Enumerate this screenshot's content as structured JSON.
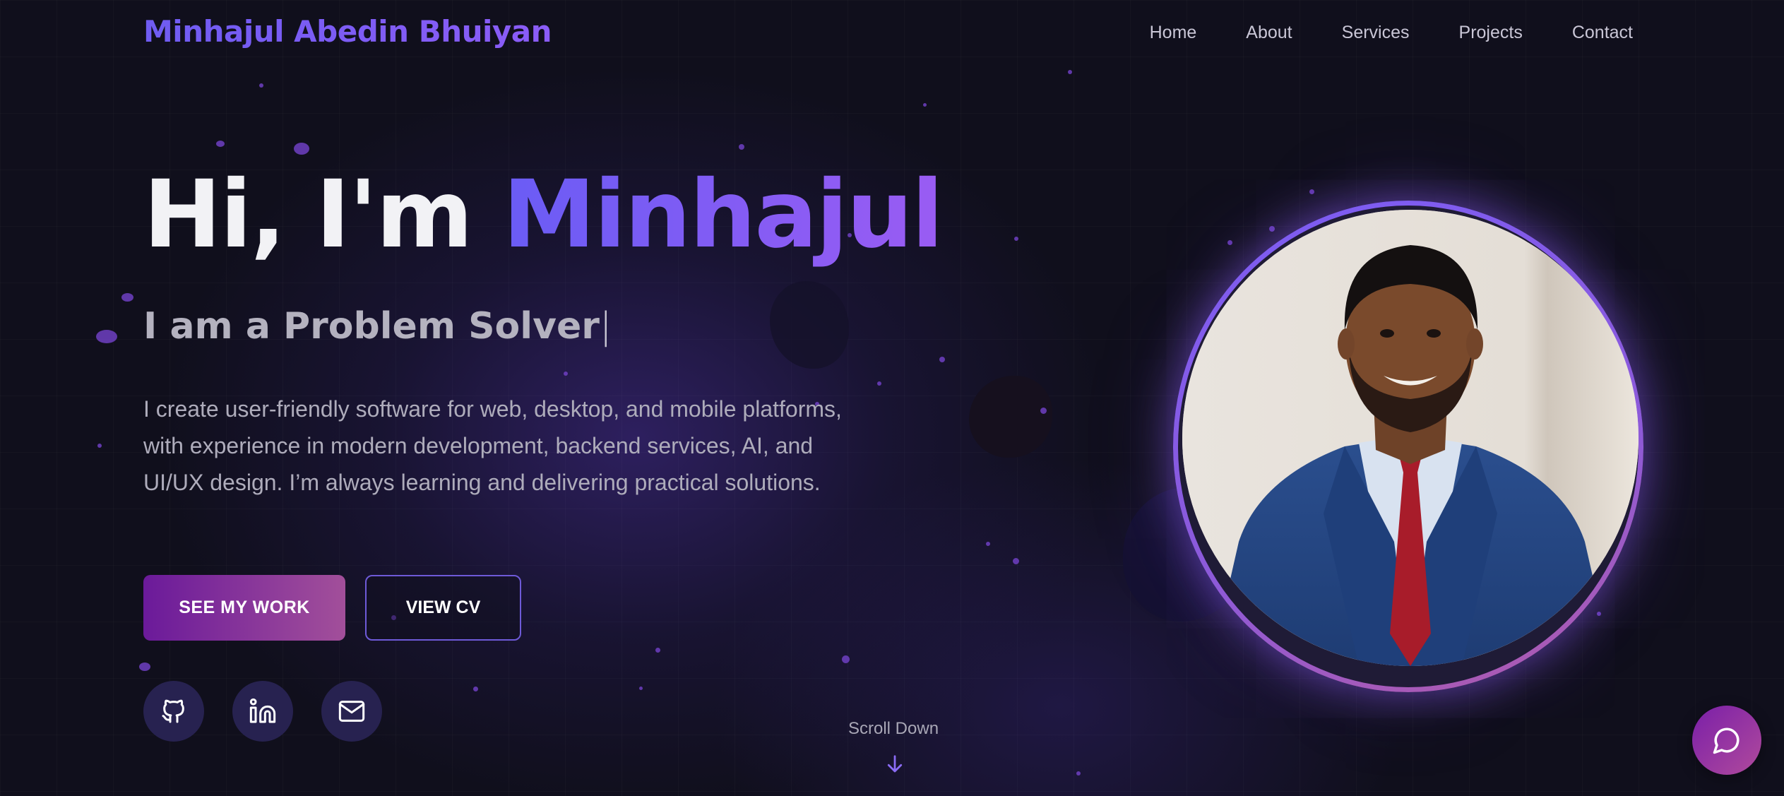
{
  "header": {
    "logo": "Minhajul Abedin Bhuiyan",
    "nav": [
      "Home",
      "About",
      "Services",
      "Projects",
      "Contact"
    ]
  },
  "hero": {
    "greeting": "Hi, I'm ",
    "name": "Minhajul",
    "subtitle": "I am a Problem Solver",
    "cursor": "|",
    "description": "I create user-friendly software for web, desktop, and mobile platforms, with experience in modern development, backend services, AI, and UI/UX design. I’m always learning and delivering practical solutions.",
    "buttons": {
      "primary": "SEE MY WORK",
      "secondary": "VIEW CV"
    },
    "social": [
      "github-icon",
      "linkedin-icon",
      "mail-icon"
    ]
  },
  "scroll": {
    "label": "Scroll Down",
    "icon": "arrow-down-icon"
  },
  "chat": {
    "icon": "chat-icon"
  },
  "colors": {
    "background": "#100f1c",
    "accent": "#7c5cf7",
    "primary_button": "#8a3a9e",
    "social_bg": "#272250"
  }
}
